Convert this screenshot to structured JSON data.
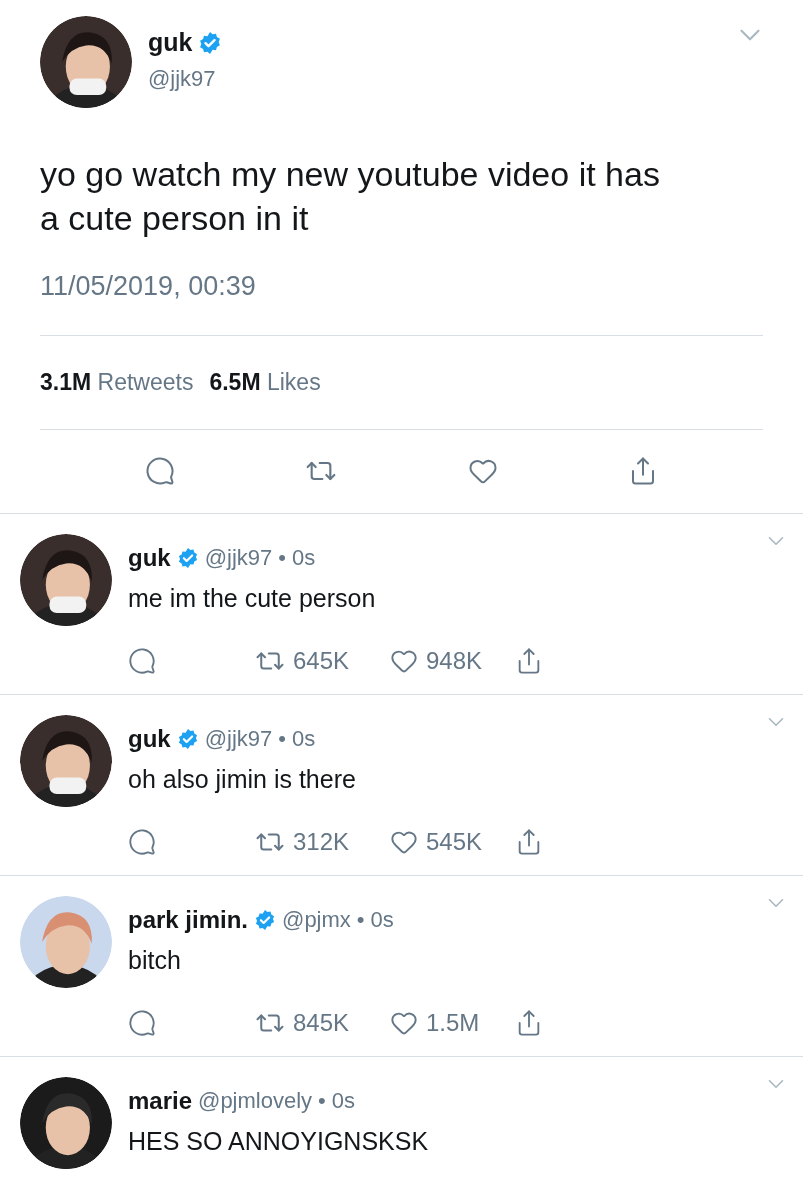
{
  "main_tweet": {
    "name": "guk",
    "verified": true,
    "handle": "@jjk97",
    "text": "yo go watch my new youtube video it has a cute person in it",
    "timestamp": "11/05/2019, 00:39",
    "stats": [
      {
        "count": "3.1M",
        "label": "Retweets"
      },
      {
        "count": "6.5M",
        "label": "Likes"
      }
    ]
  },
  "replies": [
    {
      "name": "guk",
      "verified": true,
      "handle": "@jjk97",
      "separator": "•",
      "time": "0s",
      "text": "me im the cute person",
      "retweets": "645K",
      "likes": "948K"
    },
    {
      "name": "guk",
      "verified": true,
      "handle": "@jjk97",
      "separator": "•",
      "time": "0s",
      "text": "oh also jimin is there",
      "retweets": "312K",
      "likes": "545K"
    },
    {
      "name": "park jimin.",
      "verified": true,
      "handle": "@pjmx",
      "separator": "•",
      "time": "0s",
      "text": "bitch",
      "retweets": "845K",
      "likes": "1.5M"
    },
    {
      "name": "marie",
      "verified": false,
      "handle": "@pjmlovely",
      "separator": "•",
      "time": "0s",
      "text": "HES SO ANNOYIGNSKSK"
    }
  ]
}
